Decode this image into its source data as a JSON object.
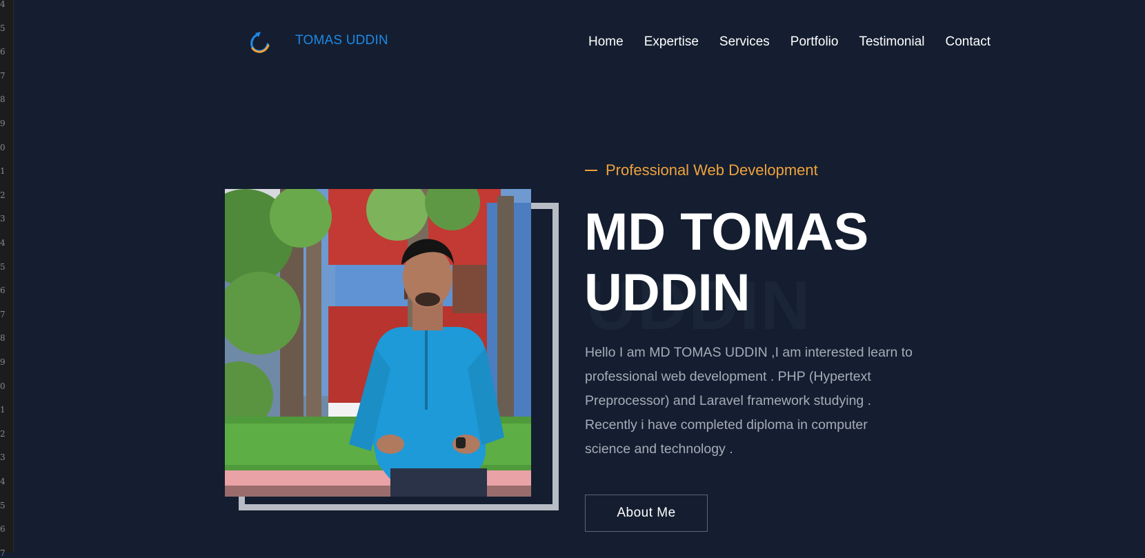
{
  "header": {
    "brand": "TOMAS UDDIN",
    "nav": [
      "Home",
      "Expertise",
      "Services",
      "Portfolio",
      "Testimonial",
      "Contact"
    ]
  },
  "hero": {
    "kicker": "Professional Web Development",
    "title_line1": "MD TOMAS",
    "title_line2": "UDDIN",
    "ghost_text": "UDDIN",
    "bio": "Hello I am MD TOMAS UDDIN ,I am interested learn to professional web development . PHP (Hypertext Preprocessor) and Laravel framework studying . Recently i have completed diploma in computer science and technology .",
    "button": "About Me"
  },
  "gutter": {
    "line_numbers": [
      "4",
      "5",
      "6",
      "7",
      "8",
      "9",
      "0",
      "1",
      "2",
      "3",
      "4",
      "5",
      "6",
      "7",
      "8",
      "9",
      "0",
      "1",
      "2",
      "3",
      "4",
      "5",
      "6",
      "7"
    ]
  },
  "icons": {
    "logo": "logo-swirl-icon"
  },
  "colors": {
    "background": "#141e30",
    "brand": "#1e88e5",
    "accent": "#f0a23c",
    "text": "#ffffff",
    "muted": "#a6acb8"
  }
}
